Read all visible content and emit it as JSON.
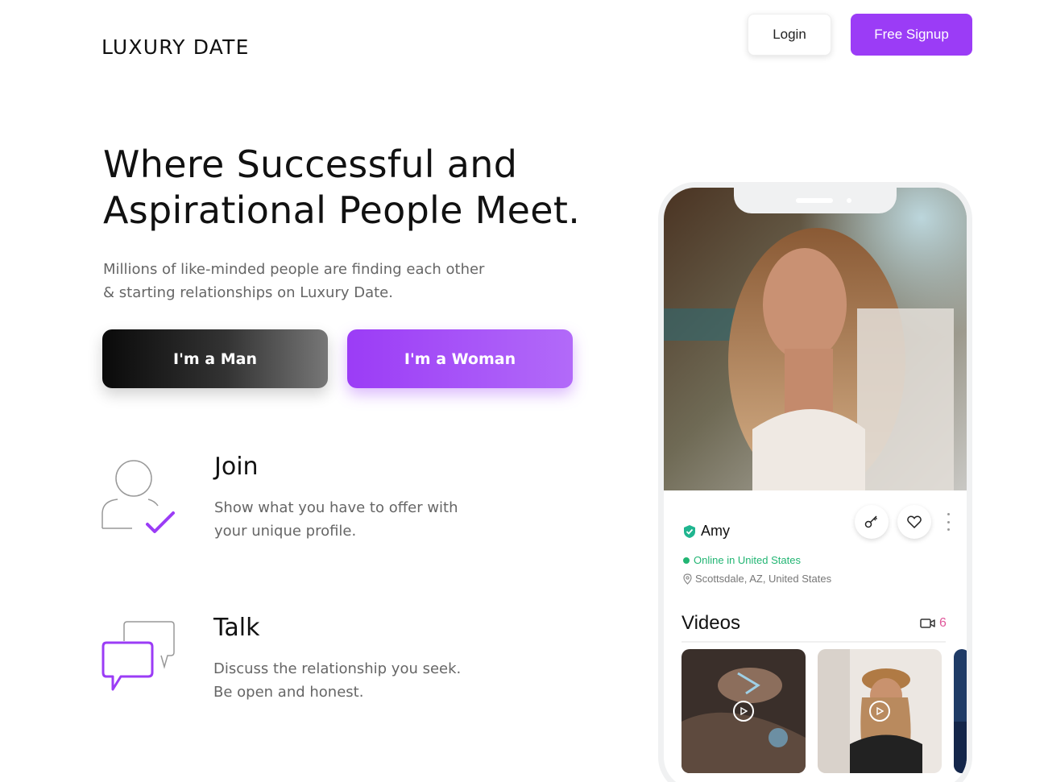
{
  "header": {
    "logo": "LUXURY DATE",
    "login_label": "Login",
    "signup_label": "Free Signup"
  },
  "hero": {
    "title_line1": "Where Successful and",
    "title_line2": "Aspirational People Meet.",
    "subtitle_line1": "Millions of like-minded people are finding each other",
    "subtitle_line2": "& starting relationships on Luxury Date.",
    "man_button": "I'm a Man",
    "woman_button": "I'm a Woman"
  },
  "features": [
    {
      "icon": "user-check-icon",
      "title": "Join",
      "desc_line1": "Show what you have to offer with",
      "desc_line2": "your unique profile."
    },
    {
      "icon": "chat-bubbles-icon",
      "title": "Talk",
      "desc_line1": "Discuss the relationship you seek.",
      "desc_line2": "Be open and honest."
    }
  ],
  "profile": {
    "name": "Amy",
    "status": "Online in United States",
    "location": "Scottsdale, AZ, United States",
    "videos_label": "Videos",
    "videos_count": "6"
  },
  "colors": {
    "brand_purple": "#9b3cf6",
    "online_green": "#22b573",
    "count_pink": "#e0579a",
    "verified_teal": "#1fb58f"
  }
}
